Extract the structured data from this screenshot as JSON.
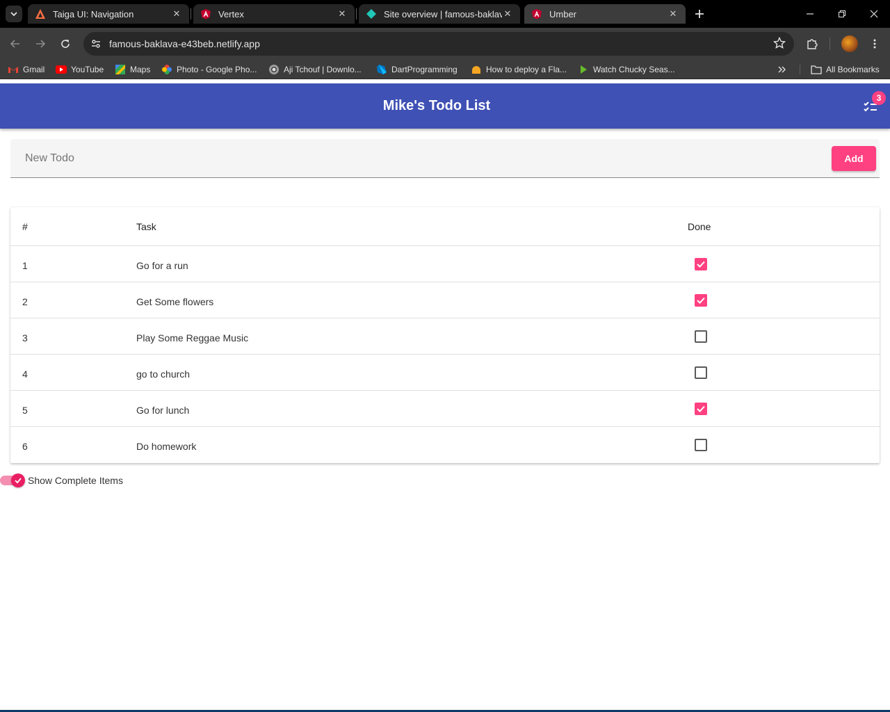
{
  "browser": {
    "tabs": [
      {
        "title": "Taiga UI: Navigation",
        "icon": "taiga-icon",
        "active": false
      },
      {
        "title": "Vertex",
        "icon": "angular-icon",
        "active": false
      },
      {
        "title": "Site overview | famous-baklava",
        "icon": "netlify-icon",
        "active": false
      },
      {
        "title": "Umber",
        "icon": "angular-icon",
        "active": true
      }
    ],
    "url": "famous-baklava-e43beb.netlify.app",
    "bookmarks": [
      {
        "label": "Gmail",
        "icon": "gmail-icon"
      },
      {
        "label": "YouTube",
        "icon": "youtube-icon"
      },
      {
        "label": "Maps",
        "icon": "maps-icon"
      },
      {
        "label": "Photo - Google Pho...",
        "icon": "photos-icon"
      },
      {
        "label": "Aji Tchouf | Downlo...",
        "icon": "globe-icon"
      },
      {
        "label": "DartProgramming",
        "icon": "dart-icon"
      },
      {
        "label": "How to deploy a Fla...",
        "icon": "cloud-icon"
      },
      {
        "label": "Watch Chucky Seas...",
        "icon": "play-icon"
      }
    ],
    "all_bookmarks_label": "All Bookmarks"
  },
  "app": {
    "title": "Mike's Todo List",
    "badge_count": "3",
    "new_todo": {
      "placeholder": "New Todo",
      "value": ""
    },
    "add_label": "Add",
    "table": {
      "headers": {
        "num": "#",
        "task": "Task",
        "done": "Done"
      },
      "rows": [
        {
          "num": "1",
          "task": "Go for a run",
          "done": true
        },
        {
          "num": "2",
          "task": "Get Some flowers",
          "done": true
        },
        {
          "num": "3",
          "task": "Play Some Reggae Music",
          "done": false
        },
        {
          "num": "4",
          "task": "go to church",
          "done": false
        },
        {
          "num": "5",
          "task": "Go for lunch",
          "done": true
        },
        {
          "num": "6",
          "task": "Do homework",
          "done": false
        }
      ]
    },
    "show_complete": {
      "label": "Show Complete Items",
      "checked": true
    }
  },
  "colors": {
    "primary": "#3f51b5",
    "accent": "#ff4081"
  }
}
